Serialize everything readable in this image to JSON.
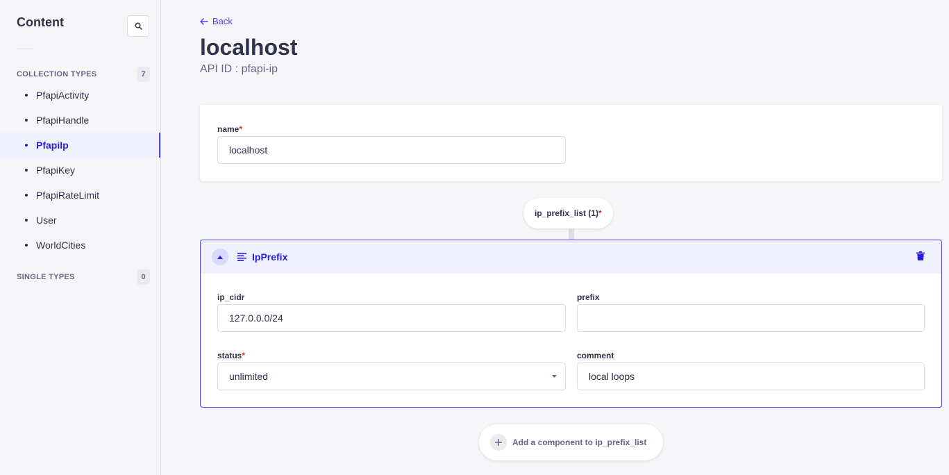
{
  "sidebar": {
    "title": "Content",
    "search_icon": "search-icon",
    "collection_types": {
      "label": "COLLECTION TYPES",
      "count": "7",
      "items": [
        {
          "label": "PfapiActivity",
          "active": false
        },
        {
          "label": "PfapiHandle",
          "active": false
        },
        {
          "label": "PfapiIp",
          "active": true
        },
        {
          "label": "PfapiKey",
          "active": false
        },
        {
          "label": "PfapiRateLimit",
          "active": false
        },
        {
          "label": "User",
          "active": false
        },
        {
          "label": "WorldCities",
          "active": false
        }
      ]
    },
    "single_types": {
      "label": "SINGLE TYPES",
      "count": "0"
    }
  },
  "header": {
    "back_label": "Back",
    "title": "localhost",
    "api_id": "API ID : pfapi-ip"
  },
  "form": {
    "name_label": "name",
    "name_required": "*",
    "name_value": "localhost"
  },
  "dynamic_zone": {
    "label": "ip_prefix_list (1)",
    "required": "*",
    "component": {
      "name": "IpPrefix",
      "ip_cidr_label": "ip_cidr",
      "ip_cidr_value": "127.0.0.0/24",
      "prefix_label": "prefix",
      "prefix_value": "",
      "status_label": "status",
      "status_required": "*",
      "status_value": "unlimited",
      "comment_label": "comment",
      "comment_value": "local loops"
    },
    "add_label": "Add a component to ip_prefix_list"
  },
  "colors": {
    "accent": "#4945ff",
    "accent_dark": "#271fe0",
    "required": "#d02b20",
    "background": "#f6f6f9"
  }
}
